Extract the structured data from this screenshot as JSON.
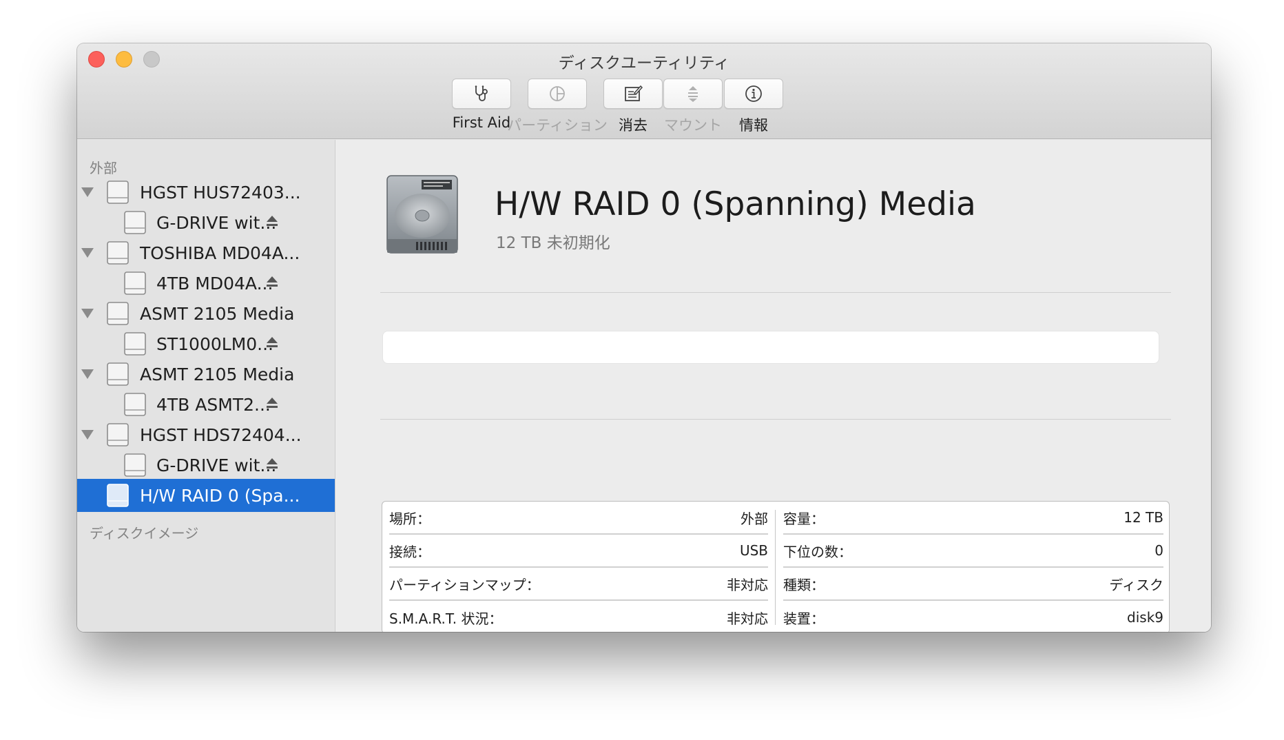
{
  "window": {
    "title": "ディスクユーティリティ"
  },
  "toolbar": {
    "items": [
      {
        "label": "First Aid",
        "icon": "stethoscope-icon",
        "enabled": true
      },
      {
        "label": "パーティション",
        "icon": "pie-partition-icon",
        "enabled": false
      },
      {
        "label": "消去",
        "icon": "erase-icon",
        "enabled": true
      },
      {
        "label": "マウント",
        "icon": "mount-icon",
        "enabled": false
      },
      {
        "label": "情報",
        "icon": "info-icon",
        "enabled": true
      }
    ]
  },
  "sidebar": {
    "section_external": "外部",
    "section_images": "ディスクイメージ",
    "items": [
      {
        "label": "HGST HUS72403...",
        "level": 0,
        "expanded": true
      },
      {
        "label": "G-DRIVE wit...",
        "level": 1,
        "ejectable": true
      },
      {
        "label": "TOSHIBA MD04A...",
        "level": 0,
        "expanded": true
      },
      {
        "label": "4TB MD04A...",
        "level": 1,
        "ejectable": true
      },
      {
        "label": "ASMT 2105 Media",
        "level": 0,
        "expanded": true
      },
      {
        "label": "ST1000LM0...",
        "level": 1,
        "ejectable": true
      },
      {
        "label": "ASMT 2105 Media",
        "level": 0,
        "expanded": true
      },
      {
        "label": "4TB ASMT2...",
        "level": 1,
        "ejectable": true
      },
      {
        "label": "HGST HDS72404...",
        "level": 0,
        "expanded": true
      },
      {
        "label": "G-DRIVE wit...",
        "level": 1,
        "ejectable": true
      },
      {
        "label": "H/W RAID 0 (Spa...",
        "level": 0,
        "selected": true
      }
    ]
  },
  "main": {
    "title": "H/W RAID 0 (Spanning) Media",
    "subtitle": "12 TB 未初期化",
    "info_left": [
      {
        "key": "場所：",
        "value": "外部"
      },
      {
        "key": "接続：",
        "value": "USB"
      },
      {
        "key": "パーティションマップ：",
        "value": "非対応"
      },
      {
        "key": "S.M.A.R.T. 状況：",
        "value": "非対応"
      }
    ],
    "info_right": [
      {
        "key": "容量：",
        "value": "12 TB"
      },
      {
        "key": "下位の数：",
        "value": "0"
      },
      {
        "key": "種類：",
        "value": "ディスク"
      },
      {
        "key": "装置：",
        "value": "disk9"
      }
    ]
  },
  "colors": {
    "selection": "#1f6fd5",
    "close": "#fc605b",
    "minimize": "#fdbc40",
    "zoom": "#c8c8c8"
  }
}
